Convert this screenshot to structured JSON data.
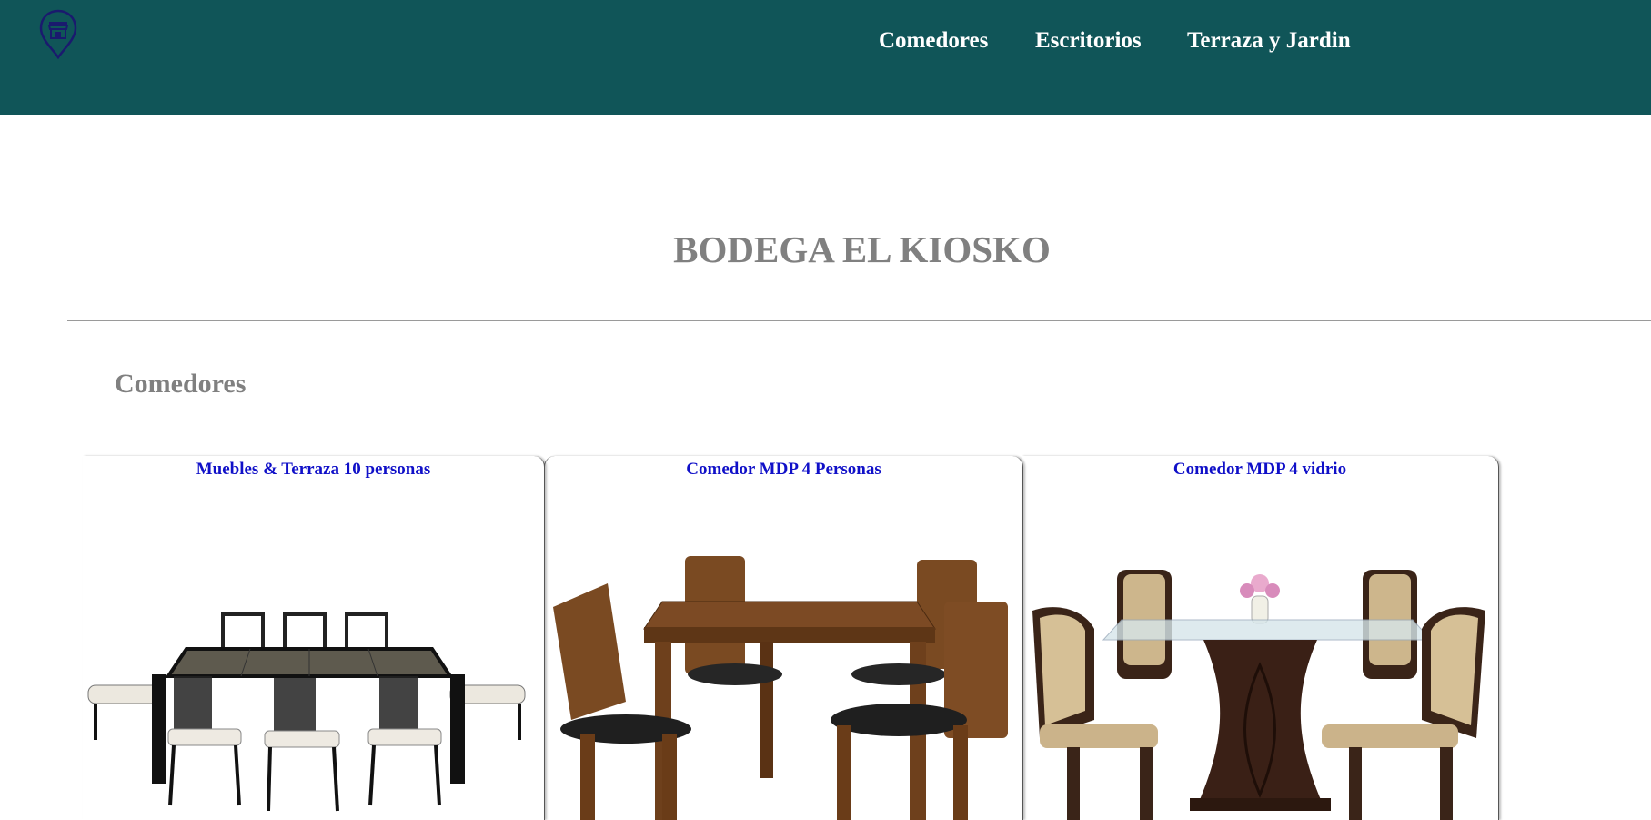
{
  "header": {
    "logo_icon": "store-location-pin-icon",
    "nav": [
      {
        "label": "Comedores"
      },
      {
        "label": "Escritorios"
      },
      {
        "label": "Terraza y Jardin"
      }
    ]
  },
  "page": {
    "title": "BODEGA EL KIOSKO"
  },
  "section": {
    "title": "Comedores",
    "products": [
      {
        "name": "Muebles & Terraza 10 personas",
        "image": "black-metal-patio-dining-set-image"
      },
      {
        "name": "Comedor MDP 4 Personas",
        "image": "wooden-dining-set-image"
      },
      {
        "name": "Comedor MDP 4 vidrio",
        "image": "glass-top-dining-set-image"
      }
    ]
  },
  "colors": {
    "header_bg": "#105558",
    "nav_text": "#ffffff",
    "title_gray": "#808080",
    "product_link": "#1010c8"
  }
}
